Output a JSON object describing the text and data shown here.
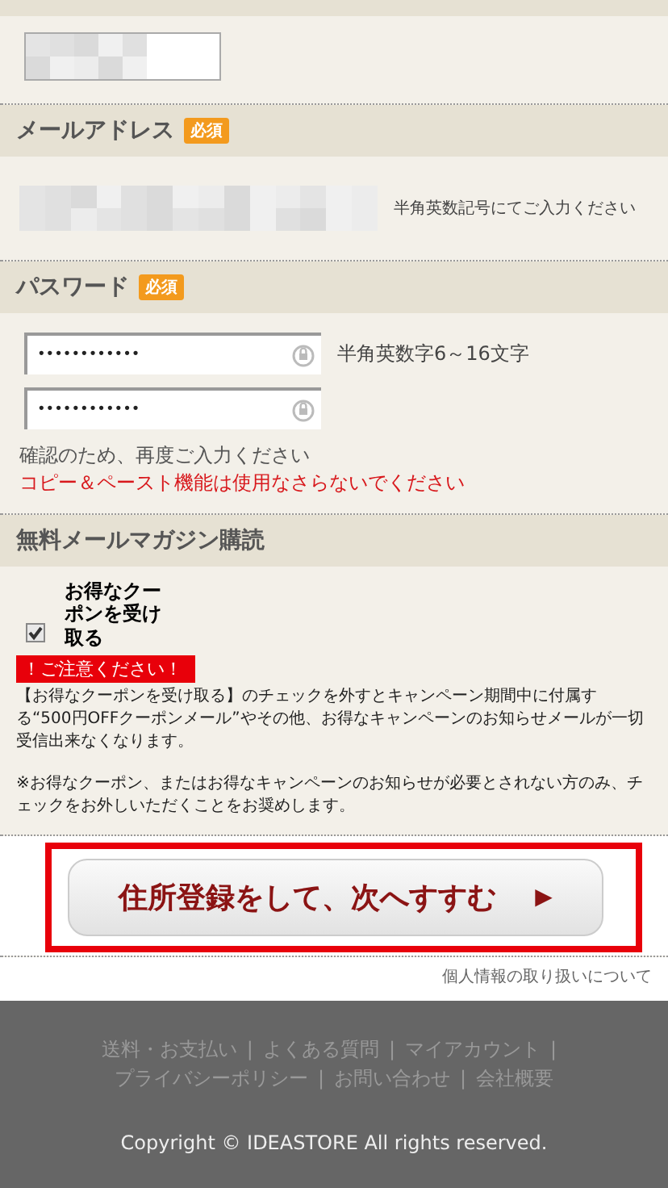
{
  "name_field": {
    "kind": "masked"
  },
  "email": {
    "label": "メールアドレス",
    "required_badge": "必須",
    "hint": "半角英数記号にてご入力ください"
  },
  "password": {
    "label": "パスワード",
    "required_badge": "必須",
    "fields": [
      {
        "value": "••••••••••••"
      },
      {
        "value": "••••••••••••"
      }
    ],
    "hint": "半角英数字6～16文字",
    "confirm_note": "確認のため、再度ご入力ください",
    "warning": "コピー＆ペースト機能は使用なさらないでください"
  },
  "newsletter": {
    "label": "無料メールマガジン購読",
    "checkbox_label": "お得なクーポンを受け取る",
    "checked": true,
    "notice_badge": "！ご注意ください！",
    "paragraphs": [
      "【お得なクーポンを受け取る】のチェックを外すとキャンペーン期間中に付属する“500円OFFクーポンメール”やその他、お得なキャンペーンのお知らせメールが一切受信出来なくなります。",
      "※お得なクーポン、またはお得なキャンペーンのお知らせが必要とされない方のみ、チェックをお外しいただくことをお奨めします。"
    ]
  },
  "submit_button": {
    "label": "住所登録をして、次へすすむ",
    "arrow": "▶"
  },
  "privacy_link": "個人情報の取り扱いについて",
  "footer": {
    "links": [
      "送料・お支払い",
      "よくある質問",
      "マイアカウント",
      "プライバシーポリシー",
      "お問い合わせ",
      "会社概要"
    ],
    "separator": "|",
    "copyright": "Copyright © IDEASTORE All rights reserved."
  }
}
